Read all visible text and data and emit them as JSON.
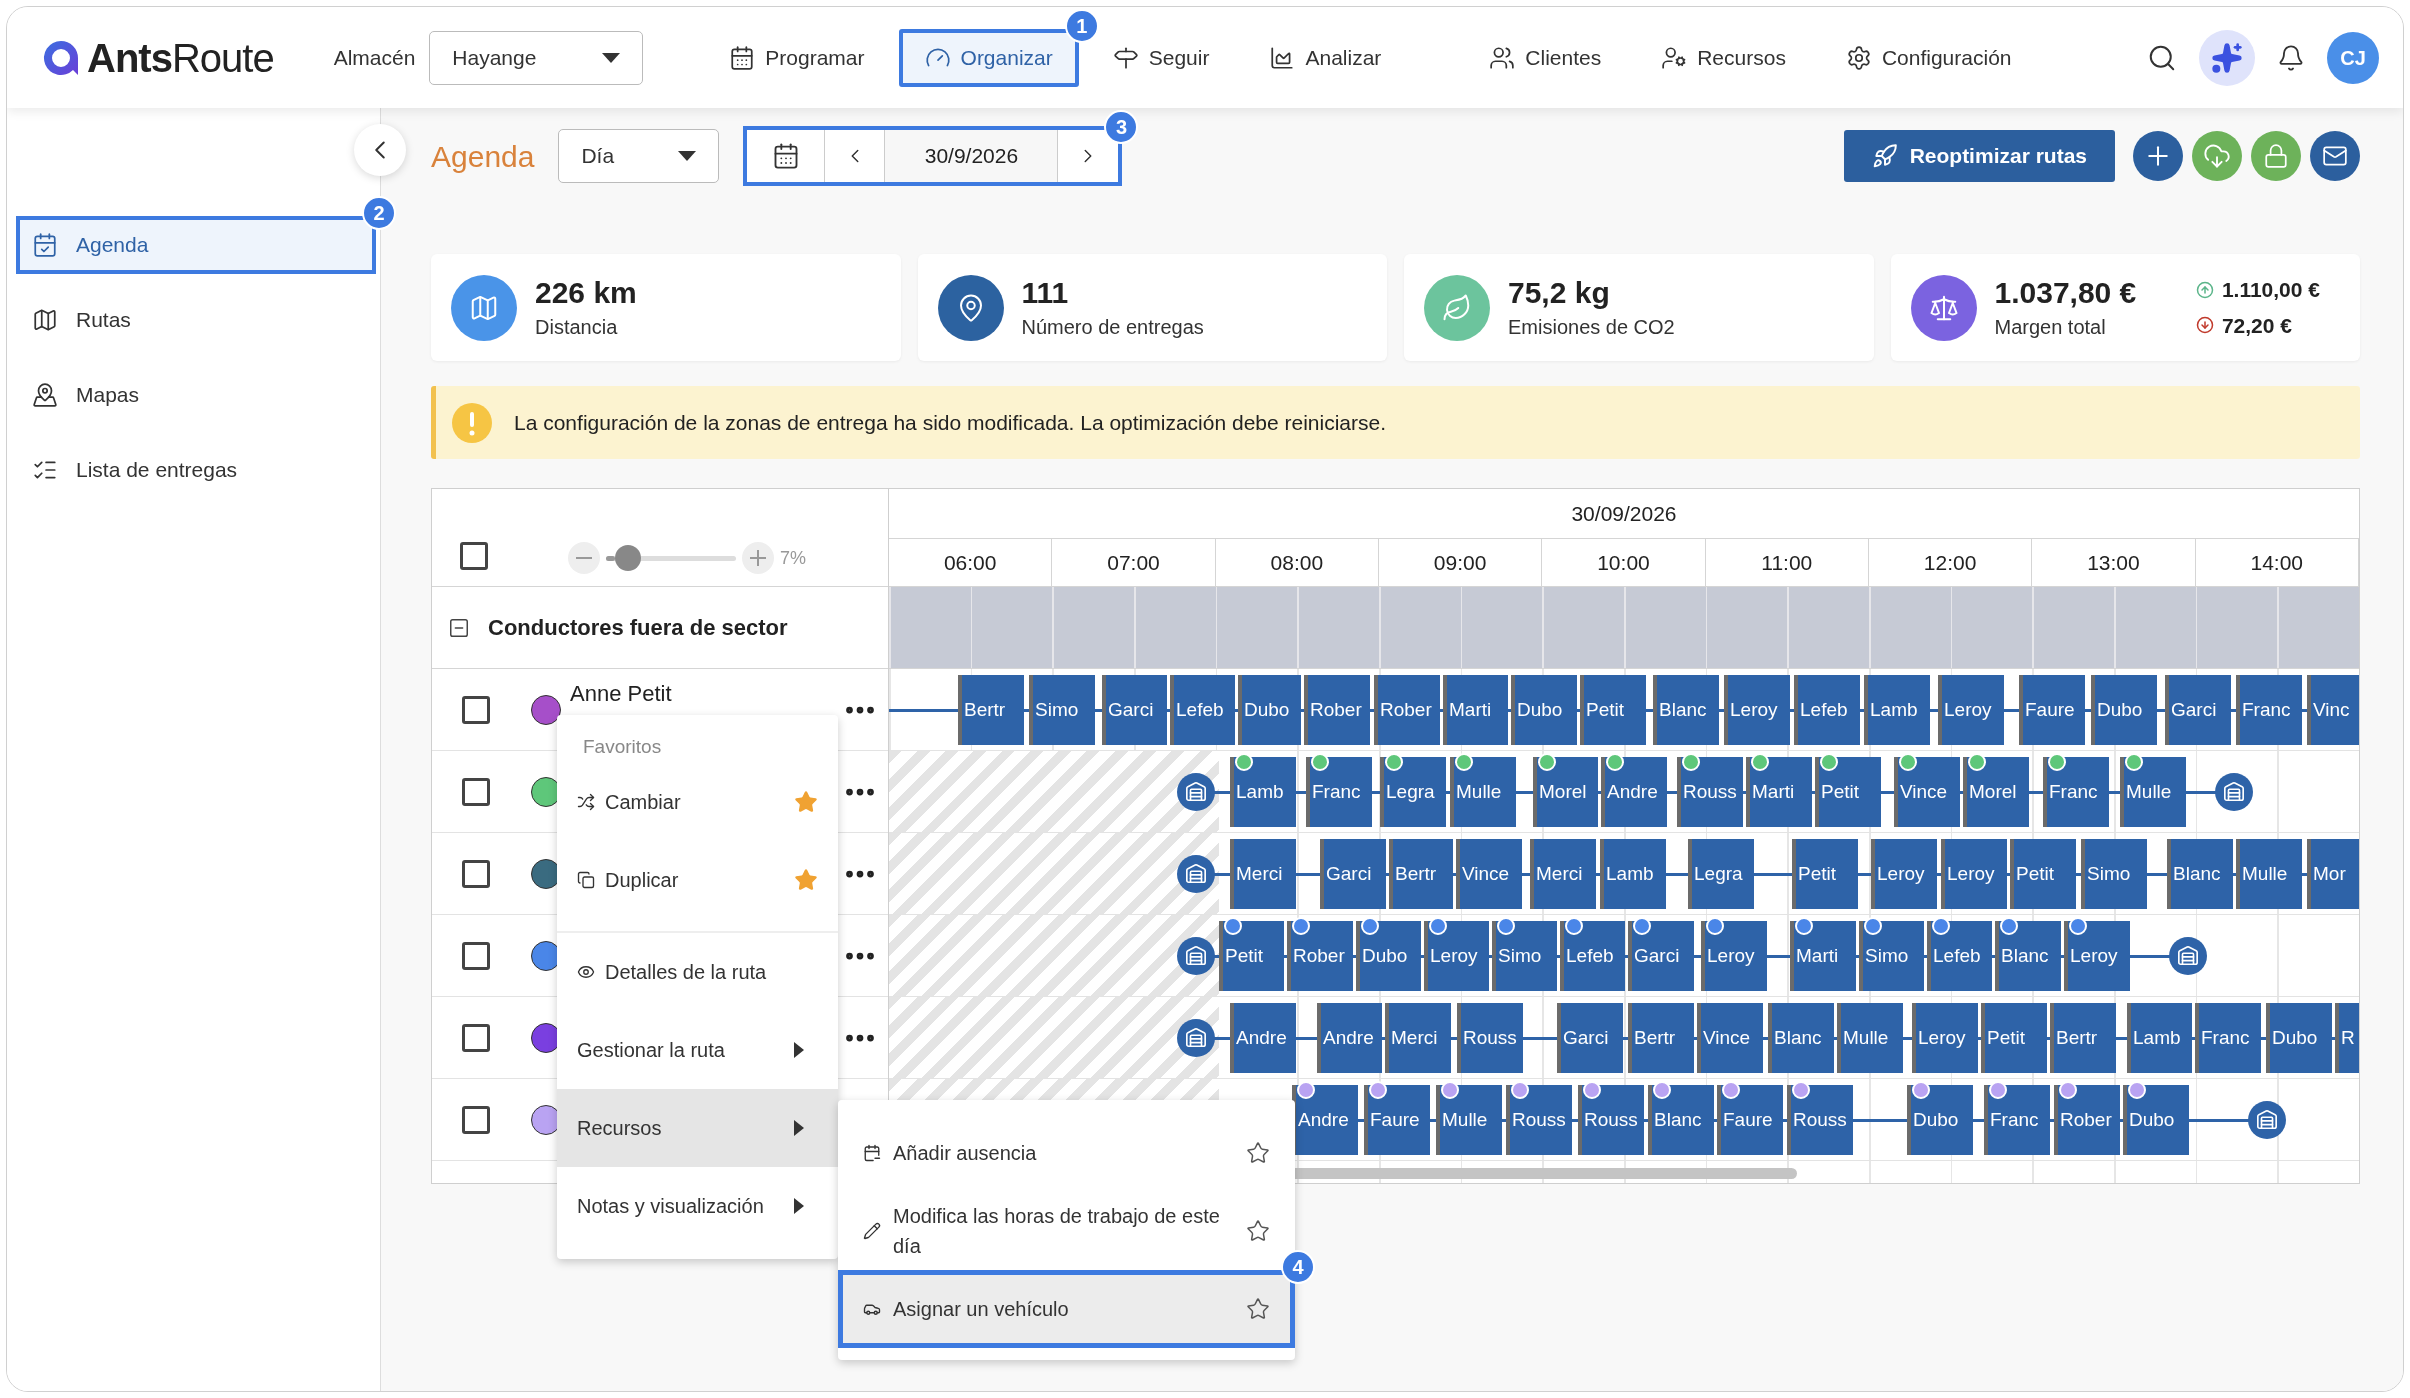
{
  "header": {
    "logo": "**Ants**Route",
    "warehouse": {
      "label": "Almacén",
      "value": "Hayange"
    },
    "nav": [
      {
        "label": "Programar",
        "selected": false
      },
      {
        "label": "Organizar",
        "selected": true,
        "callout": "1"
      },
      {
        "label": "Seguir",
        "selected": false
      },
      {
        "label": "Analizar",
        "selected": false
      },
      {
        "label": "Clientes",
        "selected": false
      },
      {
        "label": "Recursos",
        "selected": false
      },
      {
        "label": "Configuración",
        "selected": false
      }
    ],
    "avatar": "CJ"
  },
  "sidebar": {
    "items": [
      {
        "label": "Agenda",
        "selected": true,
        "callout": "2"
      },
      {
        "label": "Rutas",
        "selected": false
      },
      {
        "label": "Mapas",
        "selected": false
      },
      {
        "label": "Lista de entregas",
        "selected": false
      }
    ]
  },
  "toolbar": {
    "title": "Agenda",
    "view": "Día",
    "date_nav": {
      "date": "30/9/2026",
      "callout": "3"
    },
    "primary_action": "Reoptimizar rutas"
  },
  "stats": [
    {
      "value": "226 km",
      "label": "Distancia"
    },
    {
      "value": "111",
      "label": "Número de entregas"
    },
    {
      "value": "75,2 kg",
      "label": "Emisiones de CO2"
    },
    {
      "value": "1.037,80 €",
      "label": "Margen total",
      "income": "1.110,00 €",
      "cost": "72,20 €"
    }
  ],
  "banner": {
    "message": "La configuración de la zonas de entrega ha sido modificada. La optimización debe reiniciarse."
  },
  "gantt": {
    "select_all_checked": false,
    "zoom": {
      "level": 0.07,
      "reading": "7%"
    },
    "date": "30/09/2026",
    "hours": [
      "06:00",
      "07:00",
      "08:00",
      "09:00",
      "10:00",
      "11:00",
      "12:00",
      "13:00",
      "14:00"
    ],
    "group": {
      "title": "Conductores fuera de sector",
      "expanded": true
    },
    "routes": [
      {
        "driver": "Anne Petit",
        "color": "#a64fc9",
        "checked": false,
        "stop_markers": false,
        "stops": [
          "Bertr",
          "Simo",
          "Garci",
          "Lefeb",
          "Dubo",
          "Rober",
          "Rober",
          "Marti",
          "Dubo",
          "Petit",
          "Blanc",
          "Leroy",
          "Lefeb",
          "Lamb",
          "Leroy",
          "Faure",
          "Dubo",
          "Garci",
          "Franc",
          "Vinc"
        ]
      },
      {
        "color": "#5ec77a",
        "checked": false,
        "stop_markers": true,
        "stops": [
          "Lamb",
          "Franc",
          "Legra",
          "Mulle",
          "Morel",
          "Andre",
          "Rouss",
          "Marti",
          "Petit",
          "Vince",
          "Morel",
          "Franc",
          "Mulle"
        ]
      },
      {
        "color": "#3a6b80",
        "checked": false,
        "stop_markers": false,
        "stops": [
          "Merci",
          "Garci",
          "Bertr",
          "Vince",
          "Merci",
          "Lamb",
          "Legra",
          "Petit",
          "Leroy",
          "Leroy",
          "Petit",
          "Simo",
          "Blanc",
          "Mulle",
          "Mor"
        ]
      },
      {
        "color": "#4a86e8",
        "checked": false,
        "stop_markers": true,
        "stops": [
          "Petit",
          "Rober",
          "Dubo",
          "Leroy",
          "Simo",
          "Lefeb",
          "Garci",
          "Leroy",
          "Marti",
          "Simo",
          "Lefeb",
          "Blanc",
          "Leroy"
        ]
      },
      {
        "color": "#7a3fe0",
        "checked": false,
        "stop_markers": false,
        "stops": [
          "Andre",
          "Andre",
          "Merci",
          "Rouss",
          "Garci",
          "Bertr",
          "Vince",
          "Blanc",
          "Mulle",
          "Leroy",
          "Petit",
          "Bertr",
          "Lamb",
          "Franc",
          "Dubo",
          "R"
        ]
      },
      {
        "color": "#b9a3f2",
        "checked": false,
        "stop_markers": true,
        "stops": [
          "Andre",
          "Faure",
          "Mulle",
          "Rouss",
          "Rouss",
          "Blanc",
          "Faure",
          "Rouss",
          "Dubo",
          "Franc",
          "Rober",
          "Dubo"
        ]
      }
    ]
  },
  "context_menu": {
    "header": "Favoritos",
    "favorites": [
      {
        "label": "Cambiar",
        "starred": true
      },
      {
        "label": "Duplicar",
        "starred": true
      }
    ],
    "items": [
      {
        "label": "Detalles de la ruta",
        "submenu": false,
        "selected": false
      },
      {
        "label": "Gestionar la ruta",
        "submenu": true,
        "selected": false
      },
      {
        "label": "Recursos",
        "submenu": true,
        "selected": true
      },
      {
        "label": "Notas y visualización",
        "submenu": true,
        "selected": false
      }
    ],
    "submenu": [
      {
        "label": "Añadir ausencia",
        "starred": false,
        "selected": false
      },
      {
        "label": "Modifica las horas de trabajo de este día",
        "starred": false,
        "selected": false
      },
      {
        "label": "Asignar un vehículo",
        "starred": false,
        "selected": true,
        "callout": "4"
      }
    ]
  }
}
